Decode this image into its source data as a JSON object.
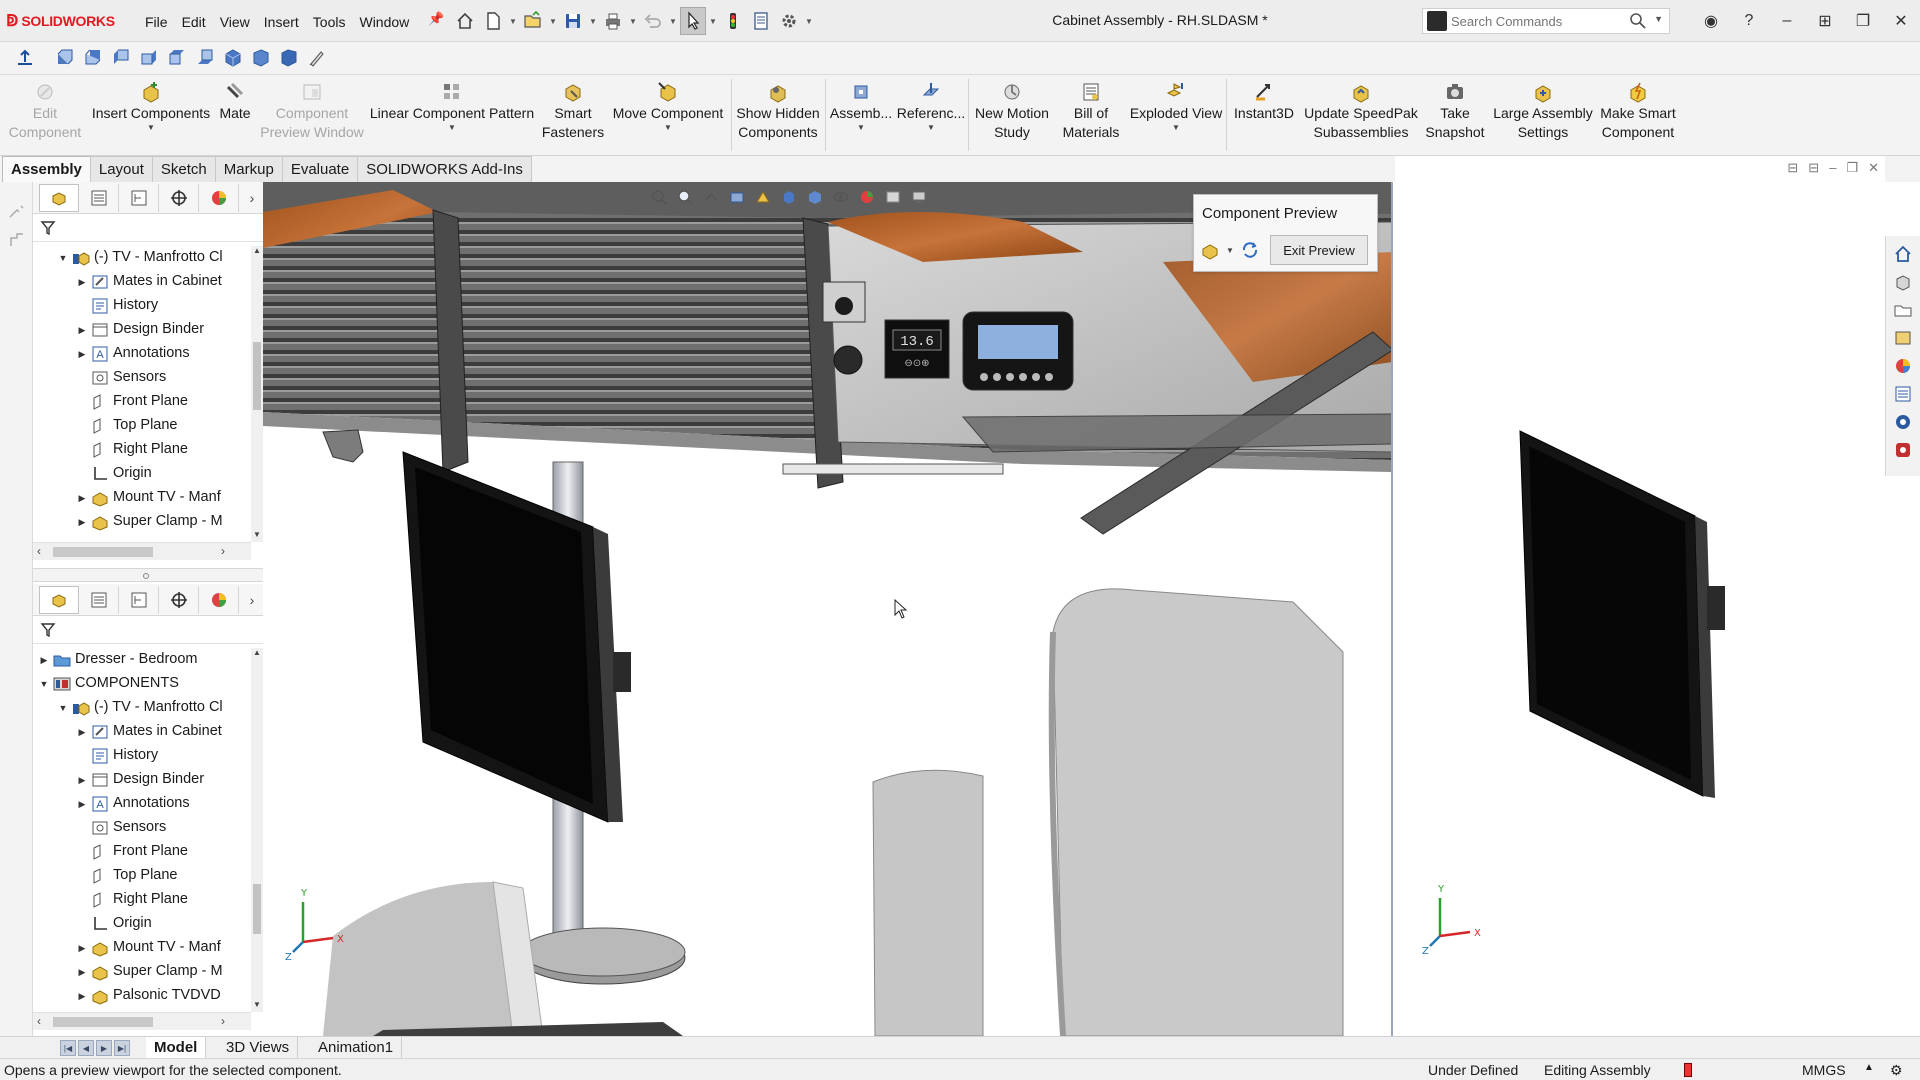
{
  "app": {
    "brand": "SOLIDWORKS",
    "document_title": "Cabinet Assembly - RH.SLDASM *",
    "accent": "#e11a22"
  },
  "menu": [
    "File",
    "Edit",
    "View",
    "Insert",
    "Tools",
    "Window"
  ],
  "search": {
    "placeholder": "Search Commands"
  },
  "command_manager": {
    "items": [
      {
        "label": "Edit\nComponent",
        "icon": "edit-component-icon",
        "enabled": false
      },
      {
        "label": "Insert Components",
        "icon": "insert-components-icon",
        "enabled": true
      },
      {
        "label": "Mate",
        "icon": "mate-icon",
        "enabled": true
      },
      {
        "label": "Component\nPreview Window",
        "icon": "preview-window-icon",
        "enabled": false
      },
      {
        "label": "Linear Component Pattern",
        "icon": "pattern-icon",
        "enabled": true
      },
      {
        "label": "Smart\nFasteners",
        "icon": "smart-fasteners-icon",
        "enabled": true
      },
      {
        "label": "Move Component",
        "icon": "move-component-icon",
        "enabled": true
      },
      {
        "label": "Show Hidden\nComponents",
        "icon": "show-hidden-icon",
        "enabled": true
      },
      {
        "label": "Assemb...",
        "icon": "assembly-features-icon",
        "enabled": true
      },
      {
        "label": "Referenc...",
        "icon": "reference-geometry-icon",
        "enabled": true
      },
      {
        "label": "New Motion\nStudy",
        "icon": "motion-study-icon",
        "enabled": true
      },
      {
        "label": "Bill of\nMaterials",
        "icon": "bom-icon",
        "enabled": true
      },
      {
        "label": "Exploded View",
        "icon": "exploded-view-icon",
        "enabled": true
      },
      {
        "label": "Instant3D",
        "icon": "instant3d-icon",
        "enabled": true
      },
      {
        "label": "Update SpeedPak\nSubassemblies",
        "icon": "speedpak-icon",
        "enabled": true
      },
      {
        "label": "Take\nSnapshot",
        "icon": "snapshot-icon",
        "enabled": true
      },
      {
        "label": "Large Assembly\nSettings",
        "icon": "large-assembly-icon",
        "enabled": true
      },
      {
        "label": "Make Smart\nComponent",
        "icon": "smart-component-icon",
        "enabled": true
      }
    ]
  },
  "cm_tabs": [
    "Assembly",
    "Layout",
    "Sketch",
    "Markup",
    "Evaluate",
    "SOLIDWORKS Add-Ins"
  ],
  "tree_top": {
    "rows": [
      {
        "text": "(-) TV - Manfrotto Cl",
        "icon": "assembly-icon",
        "indent": 1,
        "expander": "open"
      },
      {
        "text": "Mates in Cabinet",
        "icon": "mates-icon",
        "indent": 2,
        "expander": "closed"
      },
      {
        "text": "History",
        "icon": "history-icon",
        "indent": 2,
        "expander": "none"
      },
      {
        "text": "Design Binder",
        "icon": "binder-icon",
        "indent": 2,
        "expander": "closed"
      },
      {
        "text": "Annotations",
        "icon": "annotations-icon",
        "indent": 2,
        "expander": "closed"
      },
      {
        "text": "Sensors",
        "icon": "sensors-icon",
        "indent": 2,
        "expander": "none"
      },
      {
        "text": "Front Plane",
        "icon": "plane-icon",
        "indent": 2,
        "expander": "none"
      },
      {
        "text": "Top Plane",
        "icon": "plane-icon",
        "indent": 2,
        "expander": "none"
      },
      {
        "text": "Right Plane",
        "icon": "plane-icon",
        "indent": 2,
        "expander": "none"
      },
      {
        "text": "Origin",
        "icon": "origin-icon",
        "indent": 2,
        "expander": "none"
      },
      {
        "text": "Mount TV - Manf",
        "icon": "part-icon",
        "indent": 2,
        "expander": "closed"
      },
      {
        "text": "Super Clamp - M",
        "icon": "part-icon",
        "indent": 2,
        "expander": "closed"
      }
    ]
  },
  "tree_bottom": {
    "rows": [
      {
        "text": "Dresser - Bedroom",
        "icon": "folder-icon",
        "indent": 0,
        "expander": "closed"
      },
      {
        "text": "COMPONENTS",
        "icon": "components-icon",
        "indent": 0,
        "expander": "open"
      },
      {
        "text": "(-) TV - Manfrotto Cl",
        "icon": "assembly-icon",
        "indent": 1,
        "expander": "open"
      },
      {
        "text": "Mates in Cabinet",
        "icon": "mates-icon",
        "indent": 2,
        "expander": "closed"
      },
      {
        "text": "History",
        "icon": "history-icon",
        "indent": 2,
        "expander": "none"
      },
      {
        "text": "Design Binder",
        "icon": "binder-icon",
        "indent": 2,
        "expander": "closed"
      },
      {
        "text": "Annotations",
        "icon": "annotations-icon",
        "indent": 2,
        "expander": "closed"
      },
      {
        "text": "Sensors",
        "icon": "sensors-icon",
        "indent": 2,
        "expander": "none"
      },
      {
        "text": "Front Plane",
        "icon": "plane-icon",
        "indent": 2,
        "expander": "none"
      },
      {
        "text": "Top Plane",
        "icon": "plane-icon",
        "indent": 2,
        "expander": "none"
      },
      {
        "text": "Right Plane",
        "icon": "plane-icon",
        "indent": 2,
        "expander": "none"
      },
      {
        "text": "Origin",
        "icon": "origin-icon",
        "indent": 2,
        "expander": "none"
      },
      {
        "text": "Mount TV - Manf",
        "icon": "part-icon",
        "indent": 2,
        "expander": "closed"
      },
      {
        "text": "Super Clamp - M",
        "icon": "part-icon",
        "indent": 2,
        "expander": "closed"
      },
      {
        "text": "Palsonic TVDVD",
        "icon": "part-icon",
        "indent": 2,
        "expander": "closed"
      }
    ]
  },
  "component_preview": {
    "title": "Component Preview",
    "exit_label": "Exit Preview"
  },
  "cabinet_display": {
    "readout": "13.6",
    "symbols": "⊖⊙⊕"
  },
  "bottom_tabs": [
    "Model",
    "3D Views",
    "Animation1"
  ],
  "status": {
    "message": "Opens a preview viewport for the selected component.",
    "definition": "Under Defined",
    "mode": "Editing Assembly",
    "units": "MMGS"
  },
  "axis_labels": {
    "x": "X",
    "y": "Y",
    "z": "Z"
  }
}
